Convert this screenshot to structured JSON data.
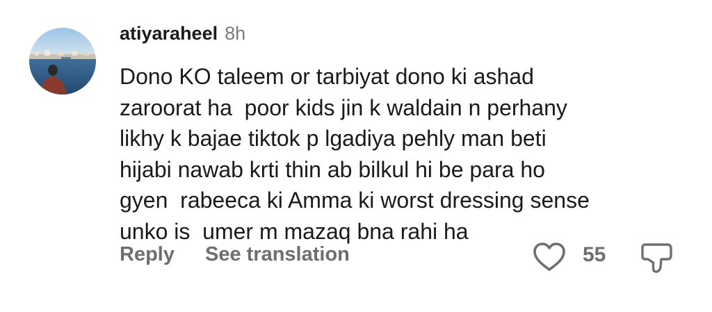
{
  "comment": {
    "username": "atiyaraheel",
    "timestamp": "8h",
    "text_lines": [
      "Dono KO taleem or tarbiyat dono ki ashad",
      "zaroorat ha  poor kids jin k waldain n perhany",
      "likhy k bajae tiktok p lgadiya pehly man beti",
      "hijabi nawab krti thin ab bilkul hi be para ho",
      "gyen  rabeeca ki Amma ki worst dressing sense",
      "unko is  umer m mazaq bna rahi ha"
    ],
    "actions": {
      "reply_label": "Reply",
      "translate_label": "See translation"
    },
    "likes": {
      "count": "55"
    },
    "icons": {
      "like": "heart-icon",
      "dislike": "thumbs-down-icon"
    }
  }
}
